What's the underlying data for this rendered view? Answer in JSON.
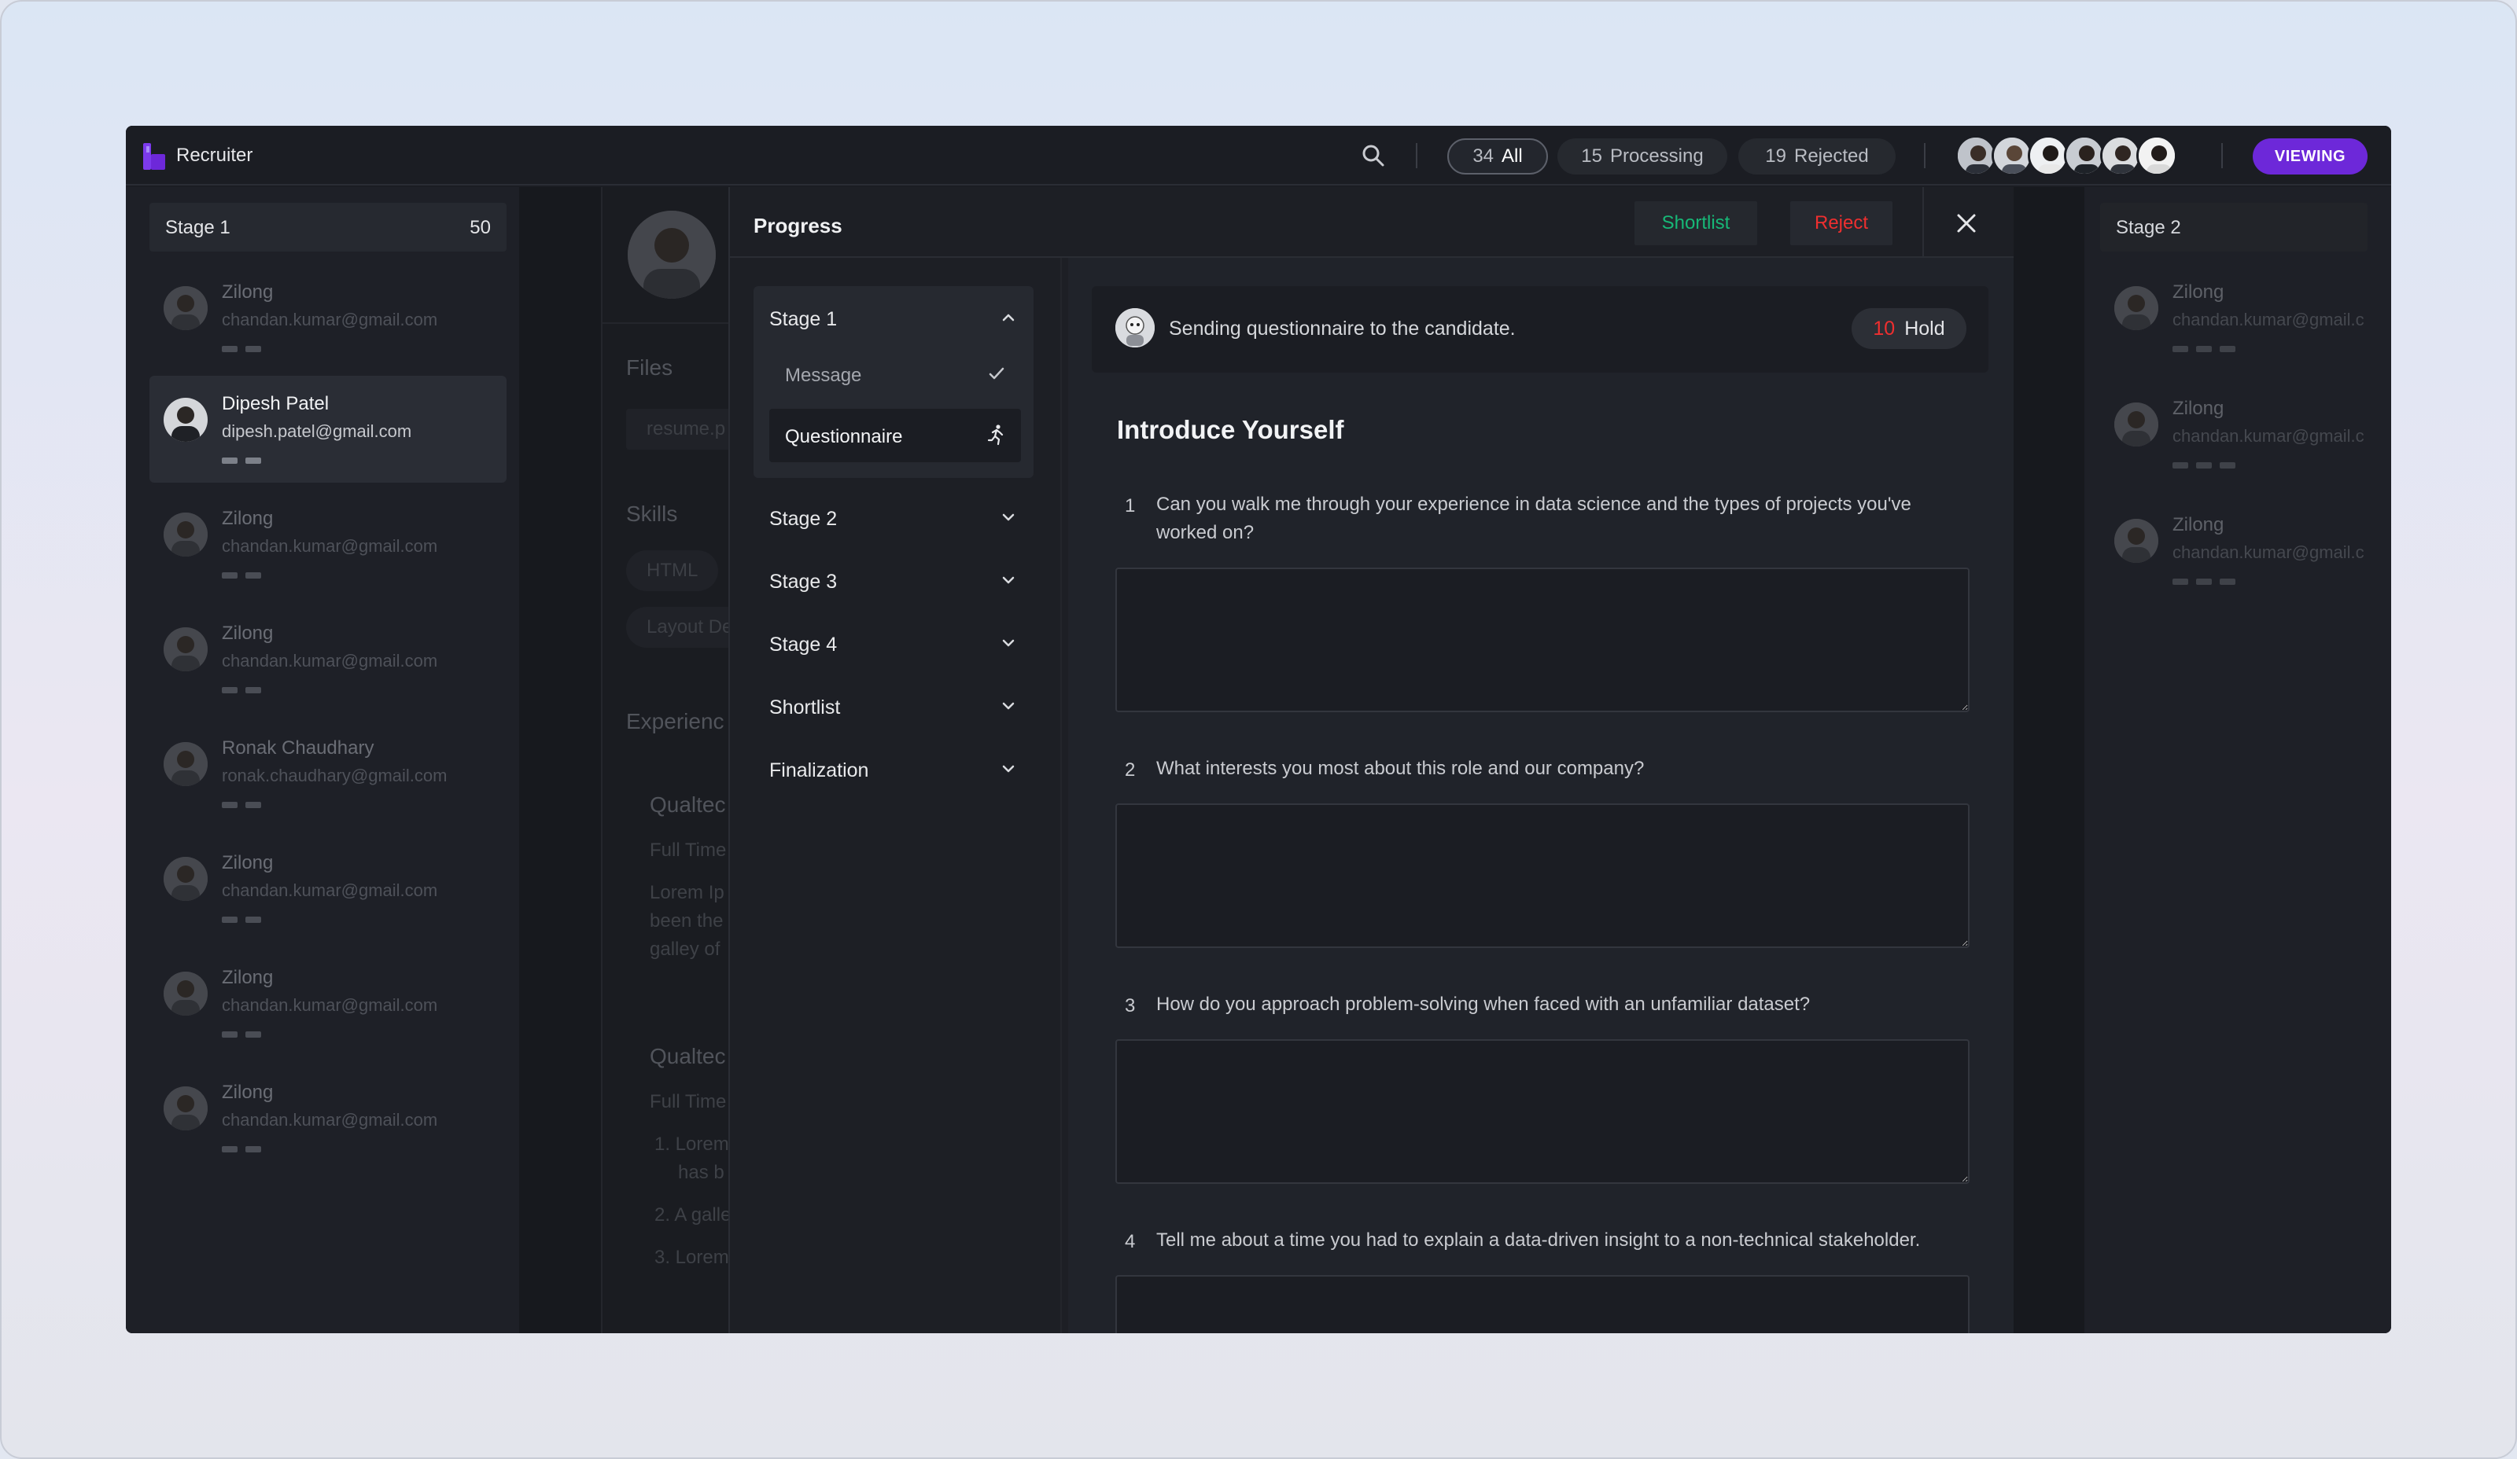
{
  "app": {
    "brand": "Recruiter",
    "colors": {
      "accent": "#6d28d9",
      "success": "#17b877",
      "danger": "#ef2f2f"
    }
  },
  "topbar": {
    "filters": [
      {
        "count": "34",
        "label": "All"
      },
      {
        "count": "15",
        "label": "Processing"
      },
      {
        "count": "19",
        "label": "Rejected"
      }
    ],
    "viewing_label": "VIEWING"
  },
  "stage1": {
    "title": "Stage 1",
    "count": "50",
    "candidates": [
      {
        "name": "Zilong",
        "email": "chandan.kumar@gmail.com"
      },
      {
        "name": "Dipesh Patel",
        "email": "dipesh.patel@gmail.com"
      },
      {
        "name": "Zilong",
        "email": "chandan.kumar@gmail.com"
      },
      {
        "name": "Zilong",
        "email": "chandan.kumar@gmail.com"
      },
      {
        "name": "Ronak Chaudhary",
        "email": "ronak.chaudhary@gmail.com"
      },
      {
        "name": "Zilong",
        "email": "chandan.kumar@gmail.com"
      },
      {
        "name": "Zilong",
        "email": "chandan.kumar@gmail.com"
      },
      {
        "name": "Zilong",
        "email": "chandan.kumar@gmail.com"
      }
    ]
  },
  "profile": {
    "files_heading": "Files",
    "file_name": "resume.p",
    "skills_heading": "Skills",
    "skills": [
      "HTML",
      "Layout De"
    ],
    "experience_heading": "Experienc",
    "jobs": [
      {
        "company": "Qualtec",
        "type": "Full Time",
        "desc": [
          "Lorem Ip",
          "been the",
          "galley of"
        ]
      },
      {
        "company": "Qualtec",
        "type": "Full Time",
        "desc": [
          "1. Lorem",
          "has b",
          "2. A galle",
          "3. Lorem"
        ]
      }
    ]
  },
  "progress": {
    "title": "Progress",
    "shortlist_label": "Shortlist",
    "reject_label": "Reject",
    "nav": {
      "stage1": "Stage 1",
      "sub": [
        "Message",
        "Questionnaire"
      ],
      "others": [
        "Stage 2",
        "Stage 3",
        "Stage 4",
        "Shortlist",
        "Finalization"
      ]
    },
    "status": {
      "text": "Sending questionnaire to the candidate.",
      "hold_count": "10",
      "hold_label": "Hold"
    },
    "section_title": "Introduce Yourself",
    "questions": [
      {
        "num": "1",
        "text": "Can you walk me through your experience in data science and the types of projects you've worked on?"
      },
      {
        "num": "2",
        "text": "What interests you most about this role and our company?"
      },
      {
        "num": "3",
        "text": "How do you approach problem-solving when faced with an unfamiliar dataset?"
      },
      {
        "num": "4",
        "text": "Tell me about a time you had to explain a data-driven insight to a non-technical stakeholder."
      }
    ]
  },
  "stage2": {
    "title": "Stage 2",
    "candidates": [
      {
        "name": "Zilong",
        "email": "chandan.kumar@gmail.c"
      },
      {
        "name": "Zilong",
        "email": "chandan.kumar@gmail.c"
      },
      {
        "name": "Zilong",
        "email": "chandan.kumar@gmail.c"
      }
    ]
  }
}
